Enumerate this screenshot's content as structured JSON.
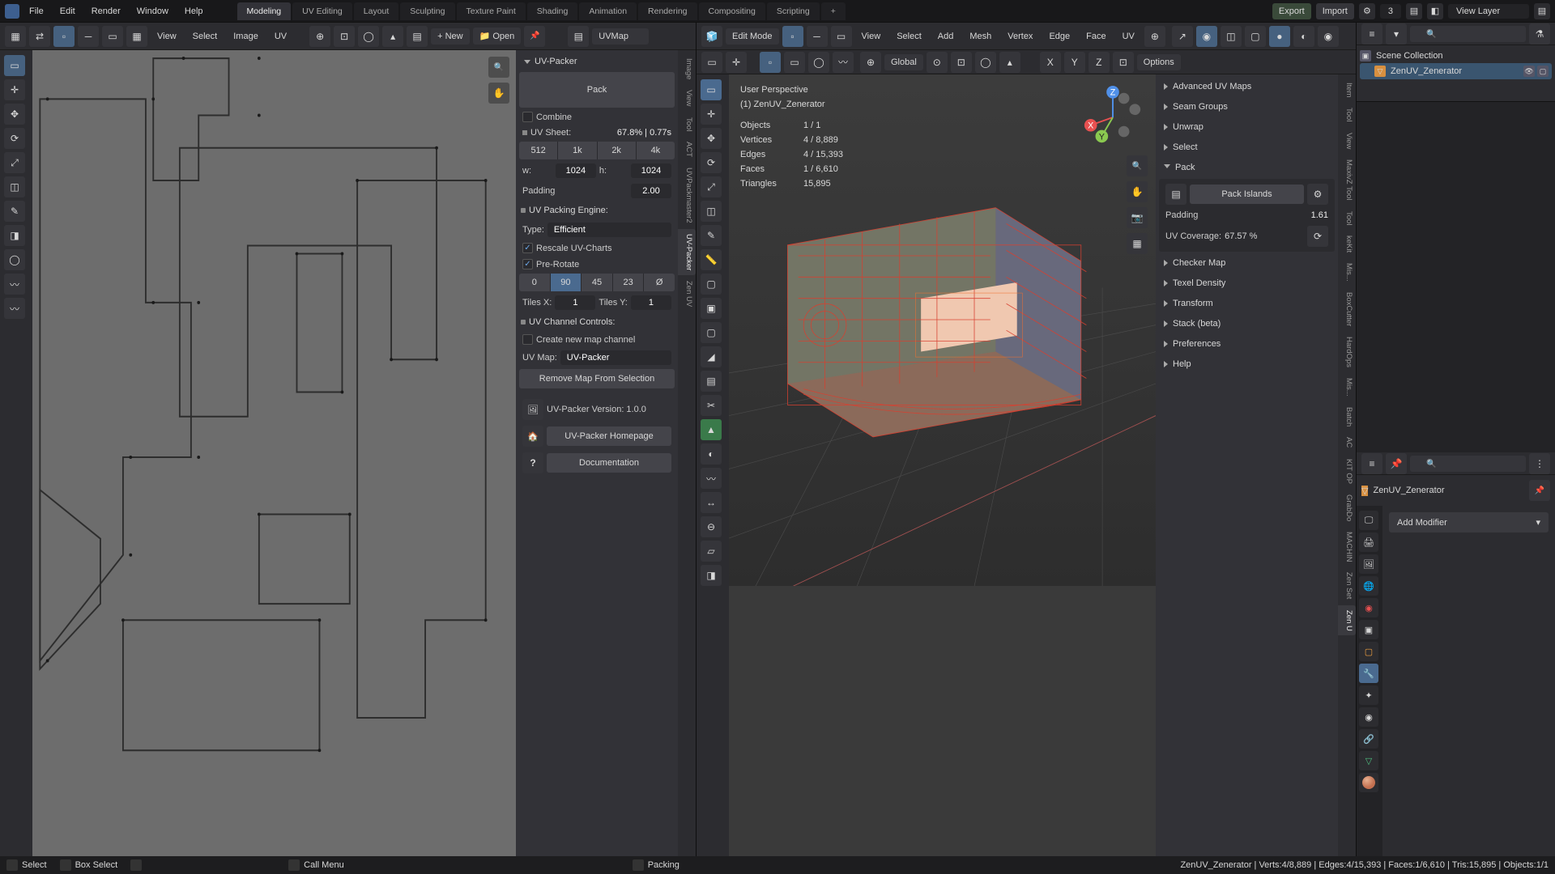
{
  "menubar": {
    "items": [
      "File",
      "Edit",
      "Render",
      "Window",
      "Help"
    ]
  },
  "workspaces": {
    "items": [
      "Modeling",
      "UV Editing",
      "Layout",
      "Sculpting",
      "Texture Paint",
      "Shading",
      "Animation",
      "Rendering",
      "Compositing",
      "Scripting"
    ],
    "active": 0,
    "plus": "+"
  },
  "topright": {
    "export": "Export",
    "import": "Import",
    "scene_num": "3",
    "viewlayer": "View Layer"
  },
  "uv": {
    "toolbar": {
      "view": "View",
      "select": "Select",
      "image": "Image",
      "uv": "UV",
      "new": "New",
      "open": "Open",
      "mapname": "UVMap"
    },
    "pin_label": "pin"
  },
  "packer": {
    "title": "UV-Packer",
    "pack": "Pack",
    "combine": "Combine",
    "sheet_label": "UV Sheet:",
    "sheet_val": "67.8% | 0.77s",
    "res": [
      "512",
      "1k",
      "2k",
      "4k"
    ],
    "w_lbl": "w:",
    "w": "1024",
    "h_lbl": "h:",
    "h": "1024",
    "padding_lbl": "Padding",
    "padding": "2.00",
    "engine_hdr": "UV Packing Engine:",
    "type_lbl": "Type:",
    "type": "Efficient",
    "rescale": "Rescale UV-Charts",
    "prerotate": "Pre-Rotate",
    "rot": [
      "0",
      "90",
      "45",
      "23",
      "Ø"
    ],
    "rot_active": 1,
    "tilesx_lbl": "Tiles X:",
    "tilesx": "1",
    "tilesy_lbl": "Tiles Y:",
    "tilesy": "1",
    "chan_hdr": "UV Channel Controls:",
    "newchan": "Create new map channel",
    "uvmap_lbl": "UV Map:",
    "uvmap": "UV-Packer",
    "remove": "Remove Map From Selection",
    "version": "UV-Packer Version: 1.0.0",
    "homepage": "UV-Packer Homepage",
    "docs": "Documentation"
  },
  "uv_ntabs": [
    "Image",
    "View",
    "Tool",
    "ACT",
    "UVPackmaster2",
    "UV-Packer",
    "Zen UV"
  ],
  "vp": {
    "mode": "Edit Mode",
    "menus": [
      "View",
      "Select",
      "Add",
      "Mesh",
      "Vertex",
      "Edge",
      "Face",
      "UV"
    ],
    "orient": "Global",
    "options": "Options",
    "overlay": {
      "persp": "User Perspective",
      "obj": "(1) ZenUV_Zenerator",
      "rows": [
        [
          "Objects",
          "1 / 1"
        ],
        [
          "Vertices",
          "4 / 8,889"
        ],
        [
          "Edges",
          "4 / 15,393"
        ],
        [
          "Faces",
          "1 / 6,610"
        ],
        [
          "Triangles",
          "15,895"
        ]
      ]
    }
  },
  "vp_ntabs": [
    "Item",
    "Tool",
    "View",
    "MaxivZ Tool",
    "Tool",
    "keKit",
    "Mis...",
    "BoxCutter",
    "HardOps",
    "Mis...",
    "Batch",
    "AC",
    "KIT OP",
    "GrabDo",
    "MACHIN",
    "Zen Set",
    "Zen U"
  ],
  "zen": {
    "sections": [
      "Advanced UV Maps",
      "Seam Groups",
      "Unwrap",
      "Select",
      "Pack",
      "Checker Map",
      "Texel Density",
      "Transform",
      "Stack (beta)",
      "Preferences",
      "Help"
    ],
    "pack_islands": "Pack Islands",
    "padding_lbl": "Padding",
    "padding": "1.61",
    "coverage_lbl": "UV Coverage:",
    "coverage": "67.57 %"
  },
  "outliner": {
    "title": "Scene Collection",
    "item": "ZenUV_Zenerator"
  },
  "props": {
    "obj": "ZenUV_Zenerator",
    "addmod": "Add Modifier"
  },
  "status": {
    "left": [
      [
        "mouse",
        "Select"
      ],
      [
        "mouse",
        "Box Select"
      ],
      [
        "mouse",
        ""
      ],
      [
        "mouse",
        "Call Menu"
      ]
    ],
    "center": [
      [
        "mouse",
        "Packing"
      ]
    ],
    "right": "ZenUV_Zenerator | Verts:4/8,889 | Edges:4/15,393 | Faces:1/6,610 | Tris:15,895 | Objects:1/1"
  }
}
